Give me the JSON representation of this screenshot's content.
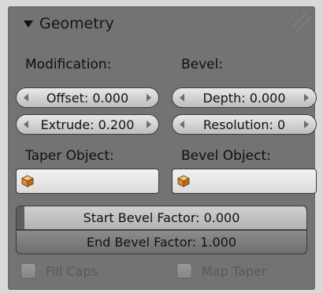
{
  "panel": {
    "title": "Geometry",
    "modification_label": "Modification:",
    "bevel_label": "Bevel:",
    "offset": "Offset: 0.000",
    "extrude": "Extrude: 0.200",
    "depth": "Depth: 0.000",
    "resolution": "Resolution: 0",
    "taper_object_label": "Taper Object:",
    "bevel_object_label": "Bevel Object:",
    "start_bevel_factor": "Start Bevel Factor: 0.000",
    "end_bevel_factor": "End Bevel Factor: 1.000",
    "fill_caps_label": "Fill Caps",
    "map_taper_label": "Map Taper",
    "fill_caps_checked": false,
    "map_taper_checked": false,
    "start_bevel_factor_value": 0.0,
    "end_bevel_factor_value": 1.0
  },
  "colors": {
    "panel_bg": "#737373",
    "field_bg": "#e4e4e4",
    "cube_orange": "#e08a2a"
  },
  "icons": {
    "collapse": "triangle-down-icon",
    "object": "cube-icon"
  }
}
